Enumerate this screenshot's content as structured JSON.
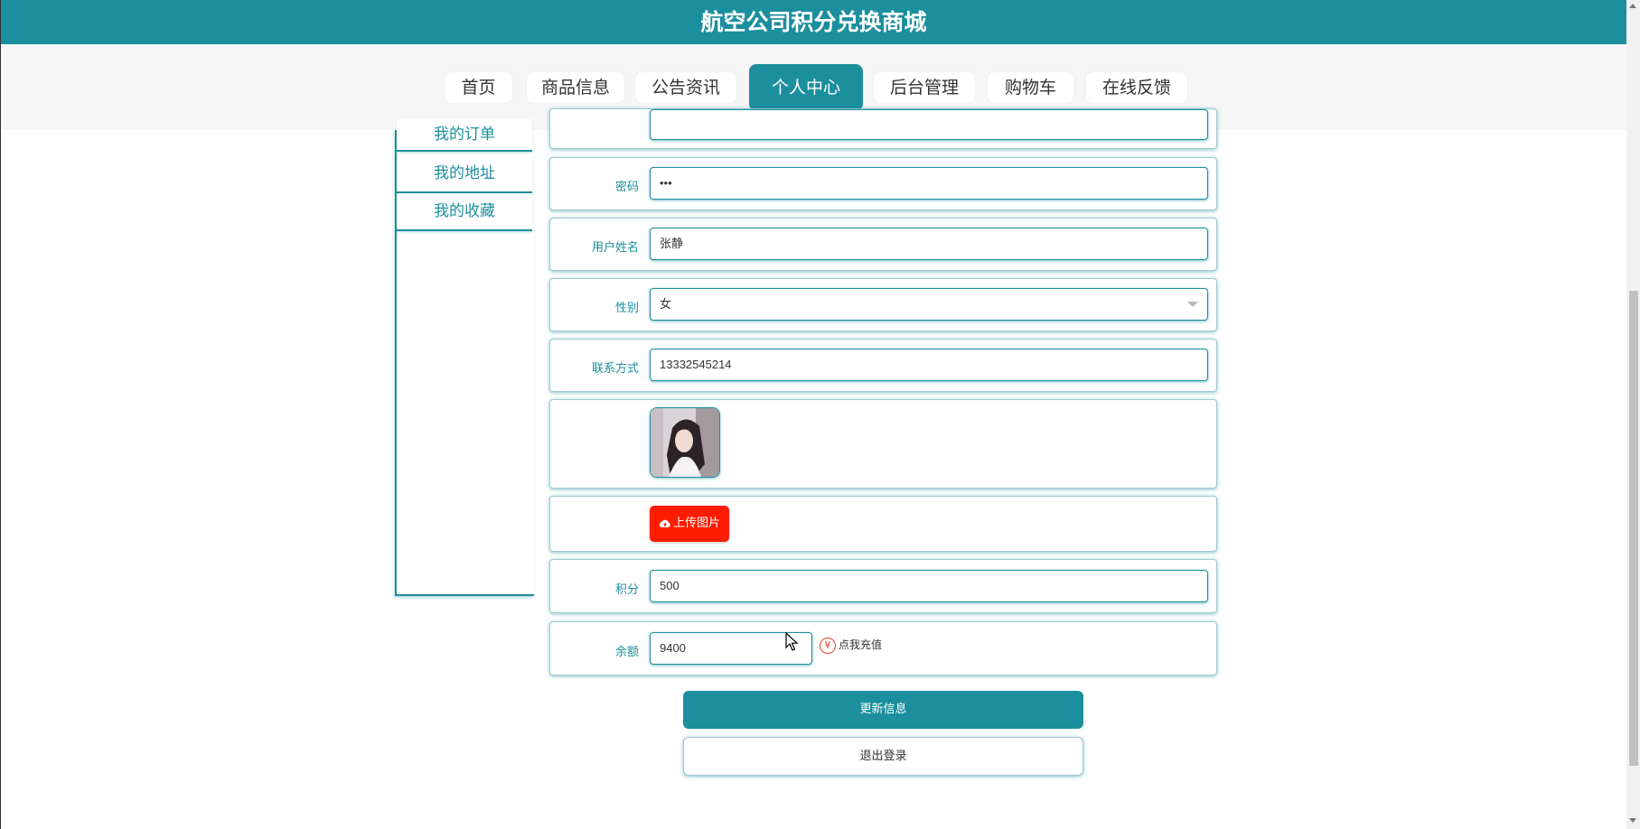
{
  "header": {
    "title": "航空公司积分兑换商城"
  },
  "nav": {
    "items": [
      {
        "label": "首页"
      },
      {
        "label": "商品信息"
      },
      {
        "label": "公告资讯"
      },
      {
        "label": "个人中心",
        "active": true
      },
      {
        "label": "后台管理"
      },
      {
        "label": "购物车"
      },
      {
        "label": "在线反馈"
      }
    ]
  },
  "sidebar": {
    "items": [
      {
        "label": "我的订单"
      },
      {
        "label": "我的地址"
      },
      {
        "label": "我的收藏"
      }
    ]
  },
  "form": {
    "password": {
      "label": "密码",
      "value": "•••"
    },
    "name": {
      "label": "用户姓名",
      "value": "张静"
    },
    "gender": {
      "label": "性别",
      "value": "女"
    },
    "phone": {
      "label": "联系方式",
      "value": "13332545214"
    },
    "upload_label": "上传图片",
    "points": {
      "label": "积分",
      "value": "500"
    },
    "balance": {
      "label": "余额",
      "value": "9400"
    },
    "recharge_label": "点我充值",
    "yen_symbol": "¥"
  },
  "actions": {
    "update_label": "更新信息",
    "logout_label": "退出登录"
  },
  "colors": {
    "accent": "#1b8f9d",
    "upload": "#ff1c00",
    "recharge_icon": "#e8402a"
  }
}
